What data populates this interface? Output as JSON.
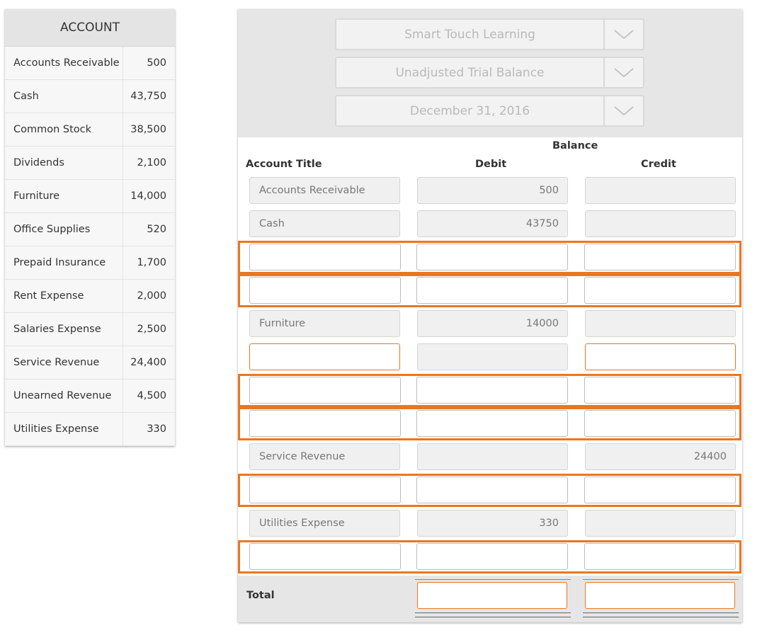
{
  "account_list": {
    "header": "ACCOUNT",
    "rows": [
      {
        "name": "Accounts Receivable",
        "value": "500"
      },
      {
        "name": "Cash",
        "value": "43,750"
      },
      {
        "name": "Common Stock",
        "value": "38,500"
      },
      {
        "name": "Dividends",
        "value": "2,100"
      },
      {
        "name": "Furniture",
        "value": "14,000"
      },
      {
        "name": "Office Supplies",
        "value": "520"
      },
      {
        "name": "Prepaid Insurance",
        "value": "1,700"
      },
      {
        "name": "Rent Expense",
        "value": "2,000"
      },
      {
        "name": "Salaries Expense",
        "value": "2,500"
      },
      {
        "name": "Service Revenue",
        "value": "24,400"
      },
      {
        "name": "Unearned Revenue",
        "value": "4,500"
      },
      {
        "name": "Utilities Expense",
        "value": "330"
      }
    ]
  },
  "worksheet": {
    "company": "Smart Touch Learning",
    "statement": "Unadjusted Trial Balance",
    "date": "December 31, 2016",
    "headers": {
      "balance": "Balance",
      "account_title": "Account Title",
      "debit": "Debit",
      "credit": "Credit"
    },
    "rows": [
      {
        "title": "Accounts Receivable",
        "debit": "500",
        "credit": ""
      },
      {
        "title": "Cash",
        "debit": "43750",
        "credit": ""
      },
      {
        "title": "",
        "debit": "",
        "credit": ""
      },
      {
        "title": "",
        "debit": "",
        "credit": ""
      },
      {
        "title": "Furniture",
        "debit": "14000",
        "credit": ""
      },
      {
        "title": "",
        "debit": "",
        "credit": ""
      },
      {
        "title": "",
        "debit": "",
        "credit": ""
      },
      {
        "title": "",
        "debit": "",
        "credit": ""
      },
      {
        "title": "Service Revenue",
        "debit": "",
        "credit": "24400"
      },
      {
        "title": "",
        "debit": "",
        "credit": ""
      },
      {
        "title": "Utilities Expense",
        "debit": "330",
        "credit": ""
      },
      {
        "title": "",
        "debit": "",
        "credit": ""
      }
    ],
    "total_label": "Total",
    "total_debit": "",
    "total_credit": ""
  },
  "colors": {
    "highlight": "#e87722",
    "header_bg": "#e6e6e6",
    "readonly_bg": "#f0f0f0"
  },
  "icons": {
    "dropdown": "chevron-down-icon"
  }
}
